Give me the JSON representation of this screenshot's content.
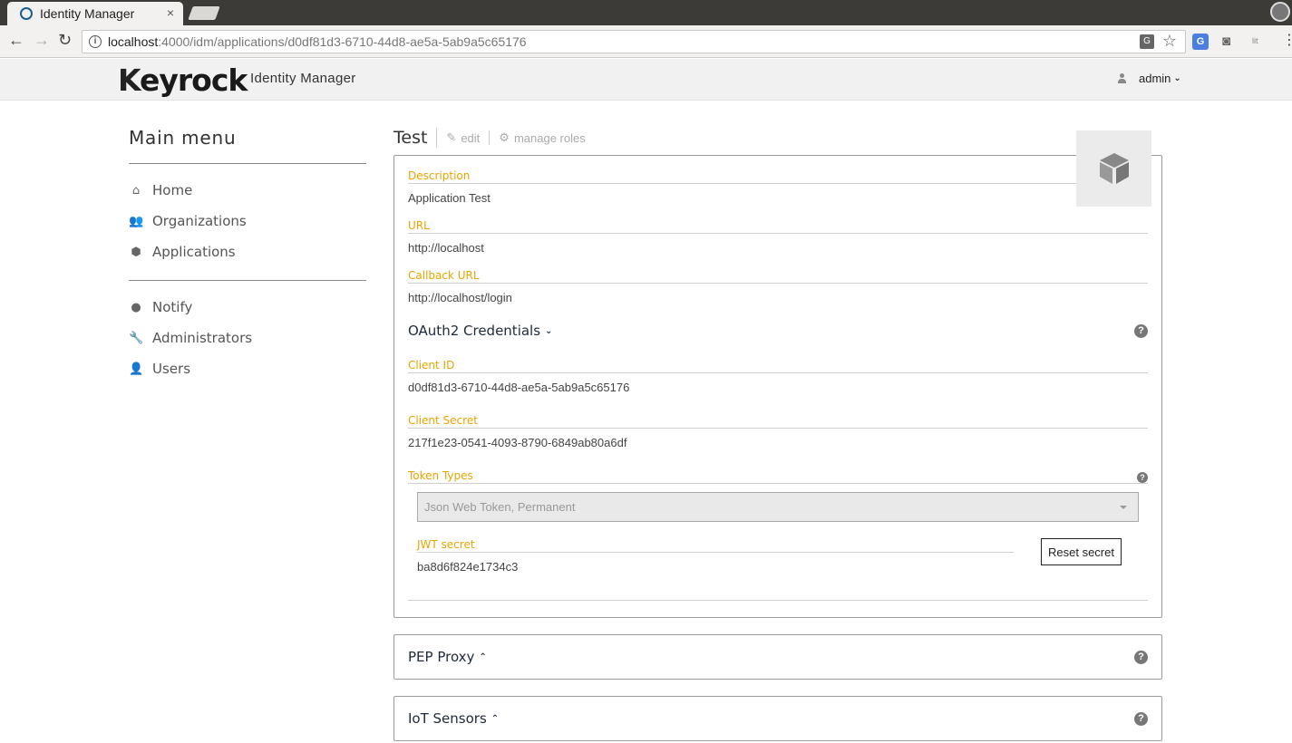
{
  "browser": {
    "tab_title": "Identity Manager",
    "tab_close": "×",
    "url_host": "localhost",
    "url_path": ":4000/idm/applications/d0df81d3-6710-44d8-ae5a-5ab9a5c65176",
    "back": "←",
    "forward": "→",
    "reload": "↻",
    "star": "☆",
    "extension_lit": "lit"
  },
  "header": {
    "logo_k": "K",
    "logo_rest": "eyrock",
    "app_name": "Identity Manager",
    "user_name": "admin",
    "user_chevron": "❯❯"
  },
  "sidebar": {
    "title": "Main menu",
    "items": [
      {
        "label": "Home",
        "icon": "home-icon",
        "glyph": "⌂"
      },
      {
        "label": "Organizations",
        "icon": "users-icon",
        "glyph": "👥"
      },
      {
        "label": "Applications",
        "icon": "cube-icon",
        "glyph": "⬢"
      }
    ],
    "admin_items": [
      {
        "label": "Notify",
        "icon": "comment-icon",
        "glyph": "●"
      },
      {
        "label": "Administrators",
        "icon": "wrench-icon",
        "glyph": "🔧"
      },
      {
        "label": "Users",
        "icon": "user-icon",
        "glyph": "👤"
      }
    ]
  },
  "application": {
    "name": "Test",
    "edit_label": "edit",
    "manage_roles_label": "manage roles",
    "description_label": "Description",
    "description": "Application Test",
    "url_label": "URL",
    "url": "http://localhost",
    "callback_label": "Callback URL",
    "callback": "http://localhost/login"
  },
  "oauth": {
    "title": "OAuth2 Credentials",
    "client_id_label": "Client ID",
    "client_id": "d0df81d3-6710-44d8-ae5a-5ab9a5c65176",
    "client_secret_label": "Client Secret",
    "client_secret": "217f1e23-0541-4093-8790-6849ab80a6df",
    "token_types_label": "Token Types",
    "token_types_value": "Json Web Token, Permanent",
    "jwt_label": "JWT secret",
    "jwt_secret": "ba8d6f824e1734c3",
    "reset_label": "Reset secret"
  },
  "pep_proxy": {
    "title": "PEP Proxy"
  },
  "iot_sensors": {
    "title": "IoT Sensors"
  },
  "help_glyph": "?",
  "colors": {
    "label_accent": "#e8a400",
    "logo_accent": "#f5a800"
  }
}
